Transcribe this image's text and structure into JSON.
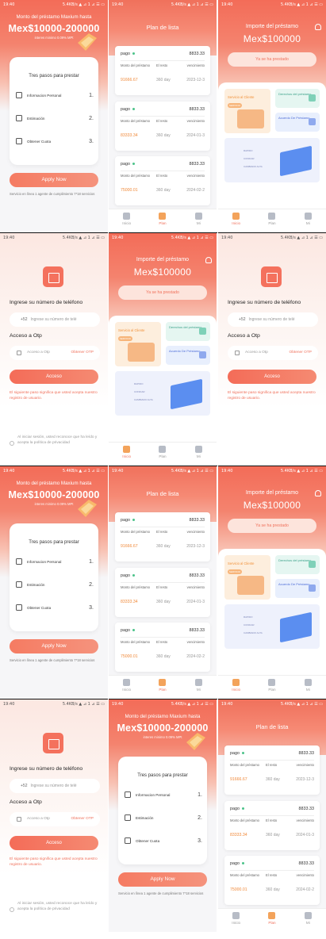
{
  "status": {
    "time": "19:40",
    "right": "5.4KB/s ▲ ⊿ 1 ⊿ ☰ ▭"
  },
  "intro": {
    "title": "Monto del préstamo Maxium hasta",
    "amount": "Mex$10000-200000",
    "rate": "interes minimo 0.09% MPt",
    "steps_heading": "Tres pasos para prestar",
    "steps": [
      {
        "label": "Informacion Personal",
        "num": "1."
      },
      {
        "label": "Estimación",
        "num": "2."
      },
      {
        "label": "Obtener Cuota",
        "num": "3."
      }
    ],
    "apply": "Apply Now",
    "service": "Servicio en línea 1 agente de cumplimiento 7*18 servicios"
  },
  "plan": {
    "title": "Plan de lista",
    "cards": [
      {
        "pago": "pago",
        "amount": "8833.33",
        "col1": "Monto del préstamo",
        "col2": "El resto",
        "col3": "vencimiento",
        "v1": "91666.67",
        "v2": "360 day",
        "v3": "2023-12-3"
      },
      {
        "pago": "pago",
        "amount": "8833.33",
        "col1": "Monto del préstamo",
        "col2": "El resto",
        "col3": "vencimiento",
        "v1": "83333.34",
        "v2": "360 day",
        "v3": "2024-01-3"
      },
      {
        "pago": "pago",
        "amount": "8833.33",
        "col1": "Monto del préstamo",
        "col2": "El resto",
        "col3": "vencimiento",
        "v1": "75000.01",
        "v2": "360 day",
        "v3": "2024-02-2"
      }
    ]
  },
  "tabs": [
    {
      "label": "Inicio"
    },
    {
      "label": "Plan"
    },
    {
      "label": "Mi"
    }
  ],
  "dashboard": {
    "title": "Importe del préstamo",
    "amount": "Mex$100000",
    "status": "Ya se ha prestado",
    "service_card": "Servicio al Cliente",
    "service_pill": "SERVICIO",
    "card_a": "Derechos del préstamo",
    "card_b": "Acuerdo De Préstamo",
    "illus_lines": [
      "RAPIDO",
      "CONFIAR",
      "CAMBIADO ALTA"
    ]
  },
  "login": {
    "phone_heading": "Ingrese su número de teléfono",
    "phone_prefix": "+52",
    "phone_placeholder": "Ingrese su número de telé",
    "otp_heading": "Acceso a Otp",
    "otp_placeholder": "Acceso a Otp",
    "otp_get": "Obtener OTP",
    "button": "Acceso",
    "note": "El siguiente paso significa que usted acepta nuestro registro de usuario.",
    "privacy": "Al iniciar sesión, usted reconoce que ha leído y acepta la política de privacidad"
  }
}
